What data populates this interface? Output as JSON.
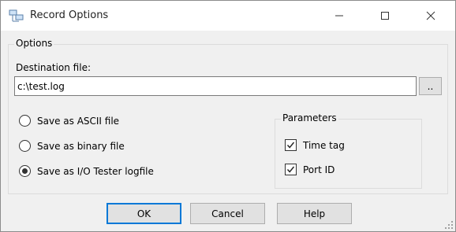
{
  "window": {
    "title": "Record Options",
    "icon": "record-options-app-icon",
    "minimize_icon": "minimize-icon",
    "maximize_icon": "maximize-icon",
    "close_icon": "close-icon"
  },
  "options": {
    "group_label": "Options",
    "destination_label": "Destination file:",
    "destination_value": "c:\\test.log",
    "browse_label": "..",
    "radios": [
      {
        "label": "Save as ASCII file",
        "checked": false
      },
      {
        "label": "Save as binary file",
        "checked": false
      },
      {
        "label": "Save as I/O Tester logfile",
        "checked": true
      }
    ]
  },
  "parameters": {
    "group_label": "Parameters",
    "checkboxes": [
      {
        "label": "Time tag",
        "checked": true
      },
      {
        "label": "Port ID",
        "checked": true
      }
    ]
  },
  "buttons": {
    "ok": "OK",
    "cancel": "Cancel",
    "help": "Help"
  },
  "colors": {
    "accent": "#0078d7",
    "window_bg": "#f0f0f0",
    "titlebar_bg": "#ffffff"
  }
}
